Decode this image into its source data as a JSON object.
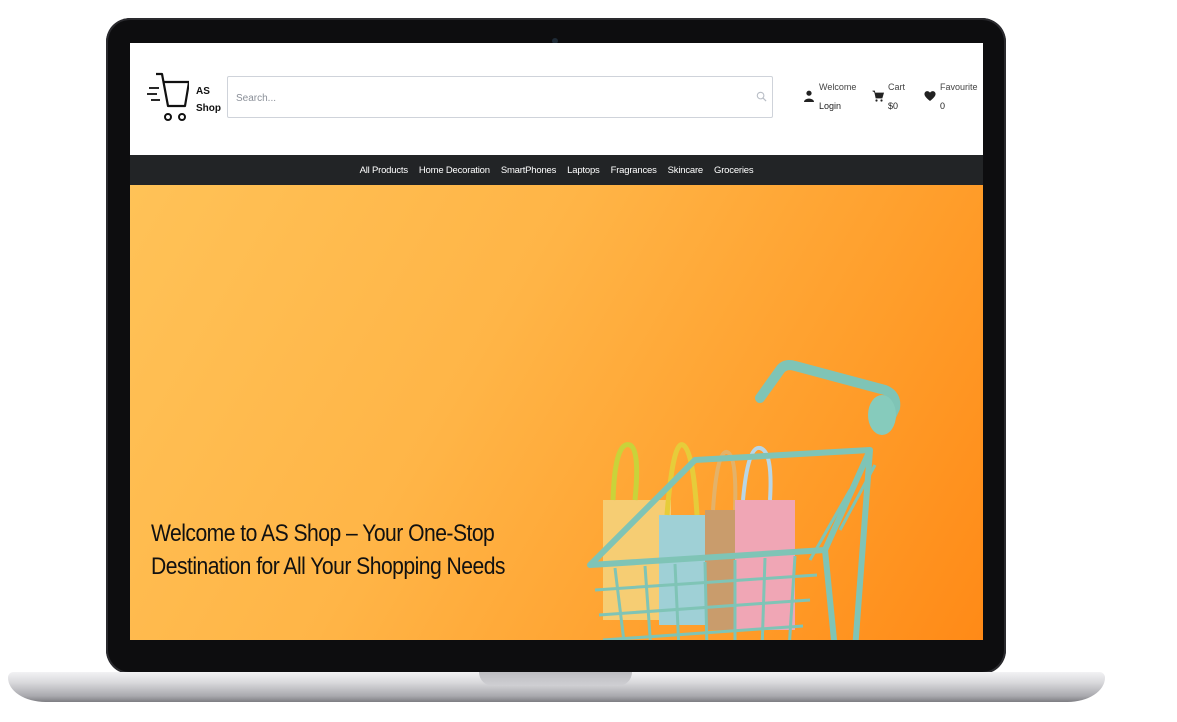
{
  "brand": {
    "line1": "AS",
    "line2": "Shop"
  },
  "search": {
    "placeholder": "Search..."
  },
  "account": {
    "top": "Welcome",
    "bottom": "Login"
  },
  "cart": {
    "top": "Cart",
    "bottom": "$0"
  },
  "favourite": {
    "top": "Favourite",
    "bottom": "0"
  },
  "nav": {
    "items": [
      "All Products",
      "Home Decoration",
      "SmartPhones",
      "Laptops",
      "Fragrances",
      "Skincare",
      "Groceries"
    ]
  },
  "hero": {
    "title": "Welcome to AS Shop – Your One-Stop Destination for All Your Shopping Needs"
  },
  "colors": {
    "nav_bg": "#222426",
    "hero_start": "#ffc257",
    "hero_end": "#ff8a17",
    "cart_teal": "#7fc4b6"
  }
}
